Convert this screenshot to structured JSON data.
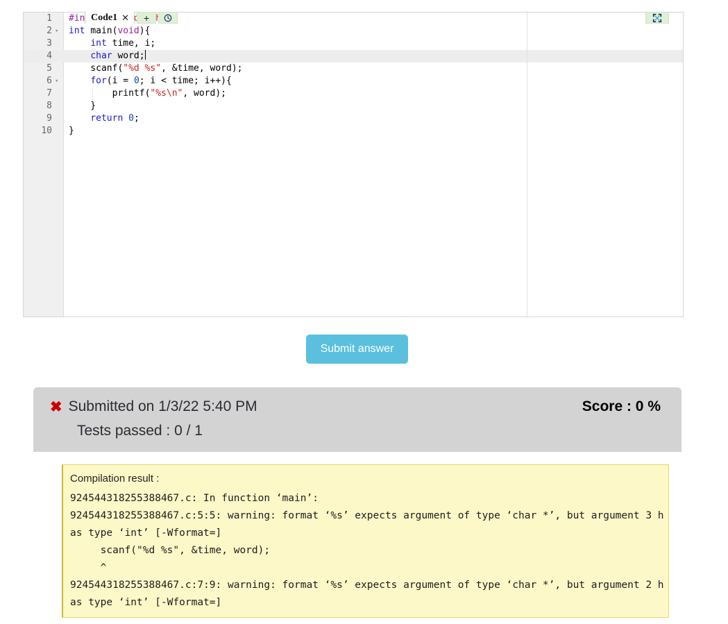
{
  "editor": {
    "tab": {
      "label": "Code1",
      "close_icon": "close-icon"
    },
    "buttons": {
      "add_label": "+",
      "history_icon": "clock-icon",
      "fullscreen_icon": "fullscreen-icon"
    },
    "active_line": 4,
    "lines": [
      {
        "n": "1",
        "fold": "",
        "tokens": [
          {
            "t": "#include ",
            "c": "k-pre"
          },
          {
            "t": "<stdio.h>",
            "c": "k-inc"
          }
        ]
      },
      {
        "n": "2",
        "fold": "▾",
        "tokens": [
          {
            "t": "int ",
            "c": "k-kw"
          },
          {
            "t": "main(",
            "c": "k-plain"
          },
          {
            "t": "void",
            "c": "k-type"
          },
          {
            "t": "){",
            "c": "k-plain"
          }
        ]
      },
      {
        "n": "3",
        "fold": "",
        "tokens": [
          {
            "t": "    ",
            "c": "k-plain"
          },
          {
            "t": "int ",
            "c": "k-kw"
          },
          {
            "t": "time, i;",
            "c": "k-plain"
          }
        ]
      },
      {
        "n": "4",
        "fold": "",
        "tokens": [
          {
            "t": "    ",
            "c": "k-plain"
          },
          {
            "t": "char ",
            "c": "k-kw"
          },
          {
            "t": "word;",
            "c": "k-plain"
          }
        ]
      },
      {
        "n": "5",
        "fold": "",
        "tokens": [
          {
            "t": "    scanf(",
            "c": "k-plain"
          },
          {
            "t": "\"%d %s\"",
            "c": "k-str"
          },
          {
            "t": ", &time, word);",
            "c": "k-plain"
          }
        ]
      },
      {
        "n": "6",
        "fold": "▾",
        "tokens": [
          {
            "t": "    ",
            "c": "k-plain"
          },
          {
            "t": "for",
            "c": "k-kw"
          },
          {
            "t": "(i = ",
            "c": "k-plain"
          },
          {
            "t": "0",
            "c": "k-num"
          },
          {
            "t": "; i < time; i++){",
            "c": "k-plain"
          }
        ]
      },
      {
        "n": "7",
        "fold": "",
        "tokens": [
          {
            "t": "        printf(",
            "c": "k-plain"
          },
          {
            "t": "\"%s\\n\"",
            "c": "k-str"
          },
          {
            "t": ", word);",
            "c": "k-plain"
          }
        ]
      },
      {
        "n": "8",
        "fold": "",
        "tokens": [
          {
            "t": "    }",
            "c": "k-plain"
          }
        ]
      },
      {
        "n": "9",
        "fold": "",
        "tokens": [
          {
            "t": "    ",
            "c": "k-plain"
          },
          {
            "t": "return ",
            "c": "k-kw"
          },
          {
            "t": "0",
            "c": "k-num"
          },
          {
            "t": ";",
            "c": "k-plain"
          }
        ]
      },
      {
        "n": "10",
        "fold": "",
        "tokens": [
          {
            "t": "}",
            "c": "k-plain"
          }
        ]
      }
    ]
  },
  "submit": {
    "label": "Submit answer"
  },
  "result": {
    "fail_icon": "✖",
    "submitted_text": "Submitted on 1/3/22 5:40 PM",
    "score_text": "Score : 0 %",
    "tests_passed_text": "Tests passed : 0 / 1",
    "compilation_title": "Compilation result :",
    "compilation_output": "924544318255388467.c: In function ‘main’:\n924544318255388467.c:5:5: warning: format ‘%s’ expects argument of type ‘char *’, but argument 3 has type ‘int’ [-Wformat=]\n     scanf(\"%d %s\", &time, word);\n     ^\n924544318255388467.c:7:9: warning: format ‘%s’ expects argument of type ‘char *’, but argument 2 has type ‘int’ [-Wformat=]"
  },
  "colors": {
    "accent_button": "#5bc0de",
    "result_header_bg": "#d3d3d3",
    "compile_box_bg": "#fcf8c8",
    "fail_red": "#cc0000",
    "toolbtn_green": "#dff0d8"
  }
}
